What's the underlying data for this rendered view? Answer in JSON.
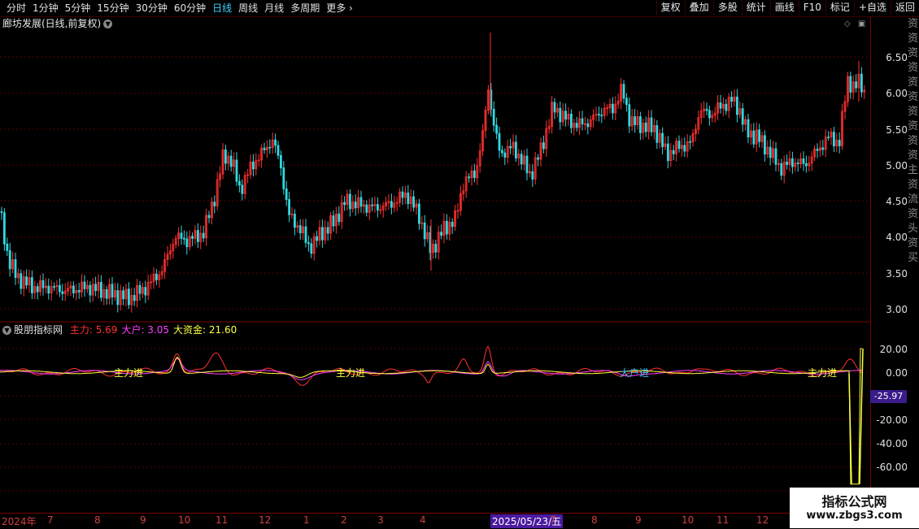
{
  "toolbar": {
    "left_items": [
      "分时",
      "1分钟",
      "5分钟",
      "15分钟",
      "30分钟",
      "60分钟",
      "日线",
      "周线",
      "月线",
      "多周期",
      "更多"
    ],
    "active": "日线",
    "right_buttons": [
      "复权",
      "叠加",
      "多股",
      "统计",
      "画线",
      "F10",
      "标记",
      "+自选",
      "返回"
    ]
  },
  "chart": {
    "title": "廊坊发展(日线,前复权)",
    "price_axis": [
      "6.50",
      "6.00",
      "5.50",
      "5.00",
      "4.50",
      "4.00",
      "3.50",
      "3.00"
    ]
  },
  "indicator": {
    "name": "股朋指标网",
    "lines": [
      {
        "label": "主力:",
        "value": "5.69",
        "color": "#ff3030"
      },
      {
        "label": "大户:",
        "value": "3.05",
        "color": "#ff40ff"
      },
      {
        "label": "大资金:",
        "value": "21.60",
        "color": "#ffff40"
      }
    ],
    "axis": [
      "20.00",
      "0.00",
      "-20.00",
      "-40.00",
      "-60.00",
      "-80.00"
    ],
    "current_value": "-25.97",
    "signals": [
      {
        "text": "主力进",
        "color": "#ffff40"
      },
      {
        "text": "主力进",
        "color": "#ffff40"
      },
      {
        "text": "大户进",
        "color": "#40c0ff"
      },
      {
        "text": "主力进",
        "color": "#ffff40"
      }
    ]
  },
  "date_axis": {
    "labels": [
      "2024年",
      "7",
      "8",
      "9",
      "10",
      "11",
      "12",
      "1",
      "2",
      "3",
      "4",
      "5",
      "6",
      "7",
      "8",
      "9",
      "10",
      "11",
      "12"
    ],
    "highlight": "2025/05/23/五"
  },
  "side_strip": [
    "资",
    "资",
    "资",
    "资",
    "资",
    "资",
    "资",
    "资",
    "资",
    "资",
    "主",
    "资",
    "流",
    "资",
    "头",
    "资",
    "买"
  ],
  "watermark": {
    "title": "指标公式网",
    "url": "www.zbgs3.com"
  },
  "colors": {
    "up": "#ff3030",
    "down": "#30d8e0",
    "grid": "#5a0000",
    "axis_border": "#7a0000"
  }
}
